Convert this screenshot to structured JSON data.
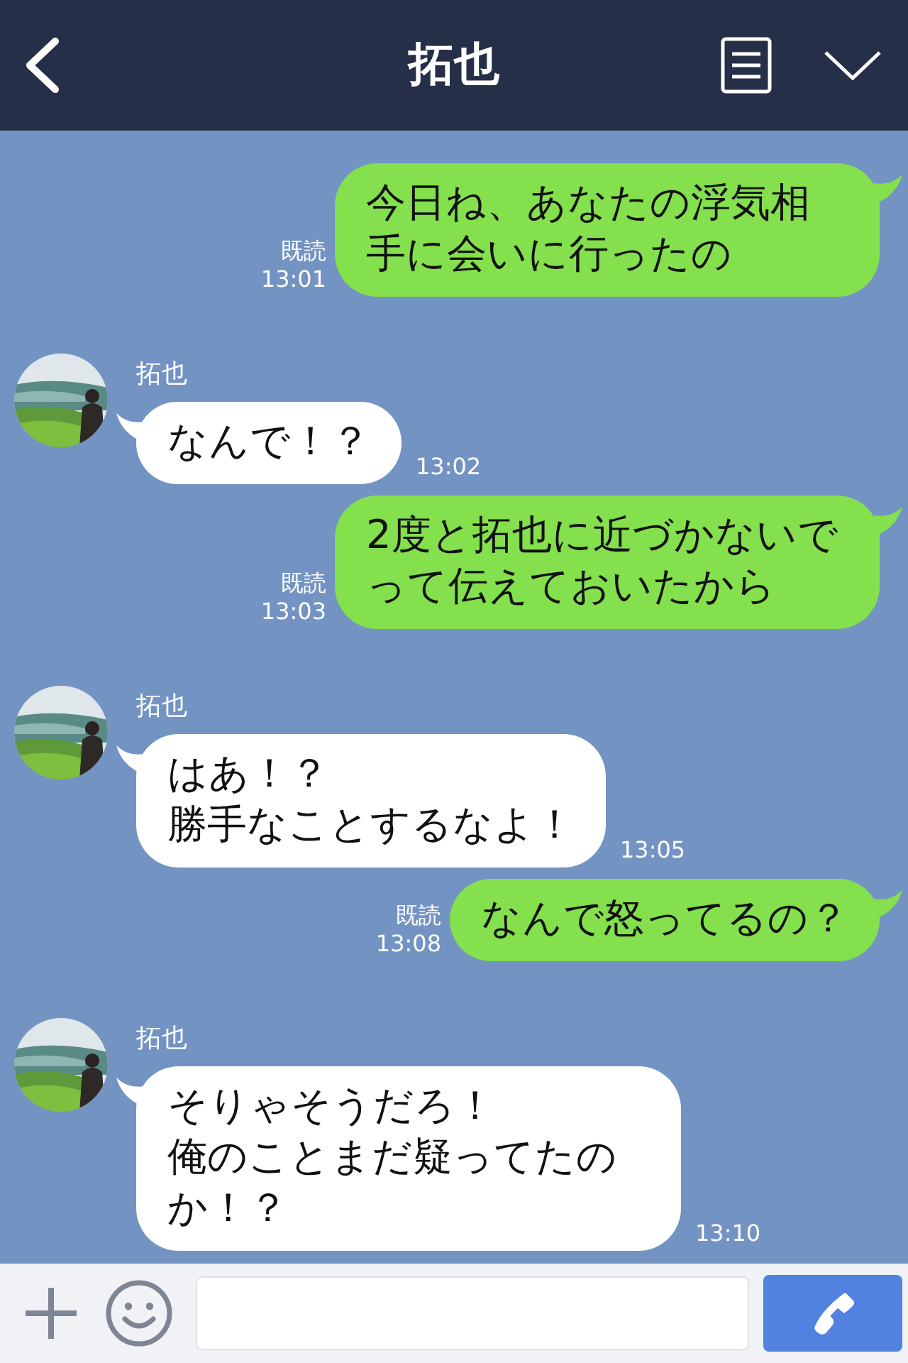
{
  "header": {
    "title": "拓也"
  },
  "messages": [
    {
      "kind": "sent",
      "lines": [
        "今日ね、あなたの浮気相手に会いに行ったの"
      ],
      "read": "既読",
      "time": "13:01"
    },
    {
      "kind": "received",
      "sender": "拓也",
      "avatar": {
        "kind": "picture"
      },
      "lines": [
        "なんで！？"
      ],
      "time": "13:02"
    },
    {
      "kind": "sent",
      "lines": [
        "2度と拓也に近づかないでって伝えておいたから"
      ],
      "read": "既読",
      "time": "13:03"
    },
    {
      "kind": "received",
      "sender": "拓也",
      "avatar": {
        "kind": "picture"
      },
      "lines": [
        "はあ！？",
        "勝手なことするなよ！"
      ],
      "time": "13:05"
    },
    {
      "kind": "sent",
      "lines": [
        "なんで怒ってるの？"
      ],
      "read": "既読",
      "time": "13:08"
    },
    {
      "kind": "received",
      "sender": "拓也",
      "avatar": {
        "kind": "picture"
      },
      "lines": [
        "そりゃそうだろ！",
        "俺のことまだ疑ってたのか！？"
      ],
      "time": "13:10"
    }
  ]
}
